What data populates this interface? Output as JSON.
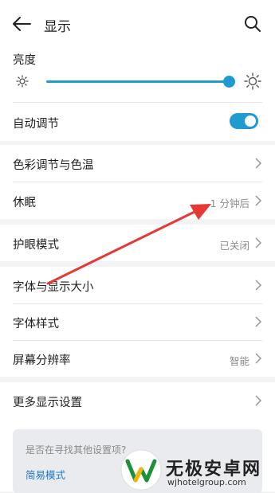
{
  "header": {
    "title": "显示"
  },
  "brightness": {
    "label": "亮度",
    "level_fraction": 0.92
  },
  "auto_adjust": {
    "label": "自动调节",
    "enabled": true
  },
  "rows": {
    "color_temp": {
      "label": "色彩调节与色温"
    },
    "sleep": {
      "label": "休眠",
      "value": "1 分钟后"
    },
    "eye_care": {
      "label": "护眼模式",
      "value": "已关闭"
    },
    "font_display_size": {
      "label": "字体与显示大小"
    },
    "font_style": {
      "label": "字体样式"
    },
    "resolution": {
      "label": "屏幕分辨率",
      "value": "智能"
    },
    "more_display": {
      "label": "更多显示设置"
    }
  },
  "suggestion_card": {
    "question": "是否在寻找其他设置项?",
    "link": "简易模式"
  },
  "watermark": {
    "brand": "无极安卓网",
    "url": "wjhotelgroup.com"
  },
  "colors": {
    "accent": "#1f9bd1",
    "annotation_arrow": "#e53935"
  }
}
